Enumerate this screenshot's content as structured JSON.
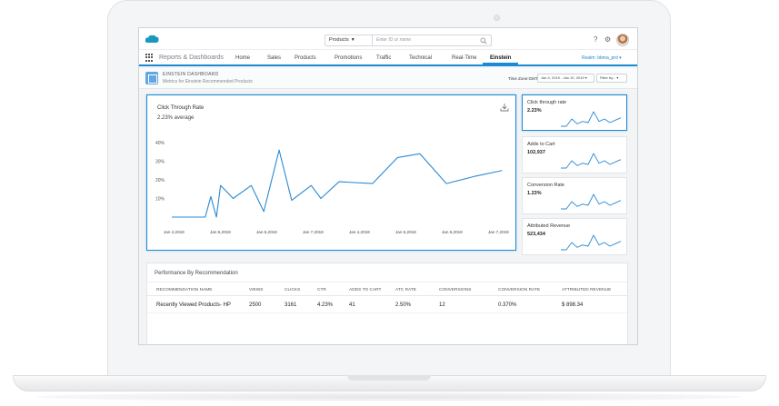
{
  "topbar": {
    "search_scope": "Products",
    "search_placeholder": "Enter ID or name",
    "help_glyph": "?",
    "settings_glyph": "⚙"
  },
  "nav": {
    "app_name": "Reports & Dashboards",
    "tabs": [
      {
        "label": "Home"
      },
      {
        "label": "Sales"
      },
      {
        "label": "Products"
      },
      {
        "label": "Promotions"
      },
      {
        "label": "Traffic"
      },
      {
        "label": "Technical"
      },
      {
        "label": "Real-Time"
      },
      {
        "label": "Einstein",
        "active": true
      }
    ],
    "realm": "Realm: bbma_prd ▾"
  },
  "dashboard": {
    "title": "EINSTEIN DASHBOARD",
    "subtitle": "Metrics for Einstein Recommended Products",
    "timezone_label": "Time Zone:GMT",
    "date_range": "Jan 4, 2019 - Jan 10, 2019 ▾",
    "filter_label": "Filter by... ▾"
  },
  "main_chart": {
    "title": "Click Through Rate",
    "value_text": "2.23% average",
    "download_icon": "download-icon"
  },
  "kpis": [
    {
      "title": "Click through rate",
      "value": "2.23%",
      "spark": [
        0,
        0,
        3,
        1,
        2,
        1.5,
        6,
        2,
        3,
        1.5,
        2.5,
        3.5
      ],
      "selected": true
    },
    {
      "title": "Adds to Cart",
      "value": "102,937",
      "spark": [
        0,
        0,
        3,
        1,
        2,
        1.5,
        6,
        2,
        3,
        1.5,
        2.5,
        3.5
      ]
    },
    {
      "title": "Conversion Rate",
      "value": "1.23%",
      "spark": [
        0,
        0,
        3,
        1,
        2,
        1.5,
        6,
        2,
        3,
        1.5,
        2.5,
        3.5
      ]
    },
    {
      "title": "Attributed Revenue",
      "value": "523,434",
      "spark": [
        0,
        0,
        3,
        1,
        2,
        1.5,
        6,
        2,
        3,
        1.5,
        2.5,
        3.5
      ]
    }
  ],
  "table": {
    "title": "Performance By Recommendation",
    "columns": [
      "Recommendation Name",
      "Views",
      "Clicks",
      "CTR",
      "Adds to Cart",
      "ATC Rate",
      "Conversions",
      "Conversion Rate",
      "Attributed Revenue"
    ],
    "rows": [
      [
        "Recently Viewed Products- HP",
        "2500",
        "3161",
        "4.23%",
        "41",
        "2.50%",
        "12",
        "0.370%",
        "$ 898.34"
      ]
    ]
  },
  "chart_data": {
    "type": "line",
    "title": "Click Through Rate",
    "xlabel": "",
    "ylabel": "",
    "ylim": [
      0,
      40
    ],
    "yticks": [
      "40%",
      "30%",
      "20%",
      "10%"
    ],
    "ytick_values": [
      40,
      30,
      20,
      10
    ],
    "xticks": [
      "Jan 4,2019",
      "Jan 5,2019",
      "Jan 6,2019",
      "Jan 7,2019",
      "Jan 4,2019",
      "Jan 5,2019",
      "Jan 6,2019",
      "Jan 7,2019"
    ],
    "grid": false,
    "series": [
      {
        "x": [
          0,
          1.2,
          1.4,
          1.6,
          1.75,
          2.2,
          2.85,
          3.3,
          3.85,
          4.3,
          5.0,
          5.35,
          6.0,
          7.2,
          8.1,
          8.9,
          9.85,
          10.9,
          11.85
        ],
        "values": [
          0,
          0,
          11,
          0,
          17,
          10,
          17,
          3,
          36,
          9,
          17,
          10,
          19,
          18,
          32,
          34,
          18,
          22,
          25
        ]
      }
    ]
  }
}
